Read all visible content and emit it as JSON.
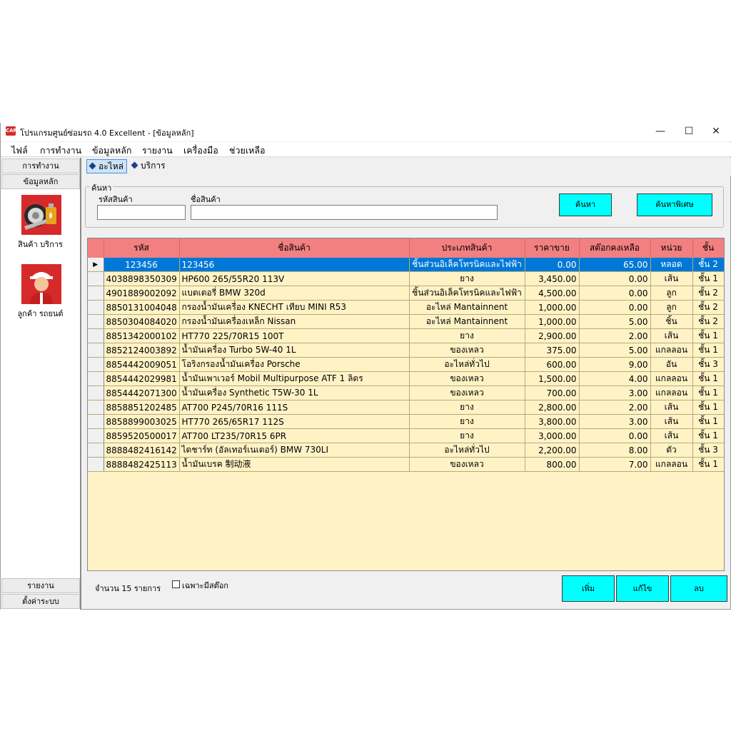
{
  "window": {
    "icon_text": "CAR",
    "title": "โปรแกรมศูนย์ซ่อมรถ 4.0 Excellent - [ข้อมูลหลัก]",
    "minimize": "—",
    "maximize": "☐",
    "close": "✕"
  },
  "menu": [
    "ไฟล์",
    "การทำงาน",
    "ข้อมูลหลัก",
    "รายงาน",
    "เครื่องมือ",
    "ช่วยเหลือ"
  ],
  "sidebar": {
    "tab_operations": "การทำงาน",
    "tab_master": "ข้อมูลหลัก",
    "items": [
      {
        "label": "สินค้า บริการ",
        "icon": "tire-oil-icon"
      },
      {
        "label": "ลูกค้า รถยนต์",
        "icon": "mechanic-icon"
      }
    ],
    "tab_reports": "รายงาน",
    "tab_settings": "ตั้งค่าระบบ"
  },
  "toolbar": {
    "parts": "อะไหล่",
    "services": "บริการ"
  },
  "search": {
    "legend": "ค้นหา",
    "code_label": "รหัสสินค้า",
    "code_value": "",
    "name_label": "ชื่อสินค้า",
    "name_value": "",
    "search_button": "ค้นหา",
    "advanced_button": "ค้นหาพิเศษ"
  },
  "table": {
    "columns": [
      "รหัส",
      "ชื่อสินค้า",
      "ประเภทสินค้า",
      "ราคาขาย",
      "สต๊อกคงเหลือ",
      "หน่วย",
      "ชั้น"
    ],
    "selected_index": 0,
    "rows": [
      [
        "123456",
        "123456",
        "ชิ้นส่วนอิเล็คโทรนิคและไฟฟ้า",
        "0.00",
        "65.00",
        "หลอด",
        "ชั้น 2"
      ],
      [
        "4038898350309",
        "HP600 265/55R20 113V",
        "ยาง",
        "3,450.00",
        "0.00",
        "เส้น",
        "ชั้น 1"
      ],
      [
        "4901889002092",
        "แบตเตอรี่ BMW 320d",
        "ชิ้นส่วนอิเล็คโทรนิคและไฟฟ้า",
        "4,500.00",
        "0.00",
        "ลูก",
        "ชั้น 2"
      ],
      [
        "8850131004048",
        "กรองน้ำมันเครื่อง KNECHT เทียบ MINI R53",
        "อะไหล่ Mantainnent",
        "1,000.00",
        "0.00",
        "ลูก",
        "ชั้น 2"
      ],
      [
        "8850304084020",
        "กรองน้ำมันเครื่องเหล็ก Nissan",
        "อะไหล่ Mantainnent",
        "1,000.00",
        "5.00",
        "ชิ้น",
        "ชั้น 2"
      ],
      [
        "8851342000102",
        "HT770 225/70R15 100T",
        "ยาง",
        "2,900.00",
        "2.00",
        "เส้น",
        "ชั้น 1"
      ],
      [
        "8852124003892",
        "น้ำมันเครื่อง Turbo 5W-40 1L",
        "ของเหลว",
        "375.00",
        "5.00",
        "แกลลอน",
        "ชั้น 1"
      ],
      [
        "8854442009051",
        "โอริงกรองน้ำมันเครื่อง Porsche",
        "อะไหล่ทั่วไป",
        "600.00",
        "9.00",
        "อัน",
        "ชั้น 3"
      ],
      [
        "8854442029981",
        "น้ำมันเพาเวอร์ Mobil Multipurpose ATF 1 ลิตร",
        "ของเหลว",
        "1,500.00",
        "4.00",
        "แกลลอน",
        "ชั้น 1"
      ],
      [
        "8854442071300",
        "น้ำมันเครื่อง Synthetic T5W-30 1L",
        "ของเหลว",
        "700.00",
        "3.00",
        "แกลลอน",
        "ชั้น 1"
      ],
      [
        "8858851202485",
        "AT700 P245/70R16 111S",
        "ยาง",
        "2,800.00",
        "2.00",
        "เส้น",
        "ชั้น 1"
      ],
      [
        "8858899003025",
        "HT770 265/65R17 112S",
        "ยาง",
        "3,800.00",
        "3.00",
        "เส้น",
        "ชั้น 1"
      ],
      [
        "8859520500017",
        "AT700 LT235/70R15 6PR",
        "ยาง",
        "3,000.00",
        "0.00",
        "เส้น",
        "ชั้น 1"
      ],
      [
        "8888482416142",
        "ไดชาร์ท (อัลเทอร์เนเตอร์) BMW 730LI",
        "อะไหล่ทั่วไป",
        "2,200.00",
        "8.00",
        "ตัว",
        "ชั้น 3"
      ],
      [
        "8888482425113",
        "น้ำมันเบรค 制动液",
        "ของเหลว",
        "800.00",
        "7.00",
        "แกลลอน",
        "ชั้น 1"
      ]
    ]
  },
  "footer": {
    "count_label": "จำนวน 15 รายการ",
    "stock_only_label": "เฉพาะมีสต๊อก",
    "stock_only_checked": false,
    "add_button": "เพิ่ม",
    "edit_button": "แก้ไข",
    "delete_button": "ลบ"
  },
  "colors": {
    "header_bg": "#f28080",
    "grid_bg": "#fff3c6",
    "selection": "#0078d7",
    "button_bg": "#00ffff"
  }
}
